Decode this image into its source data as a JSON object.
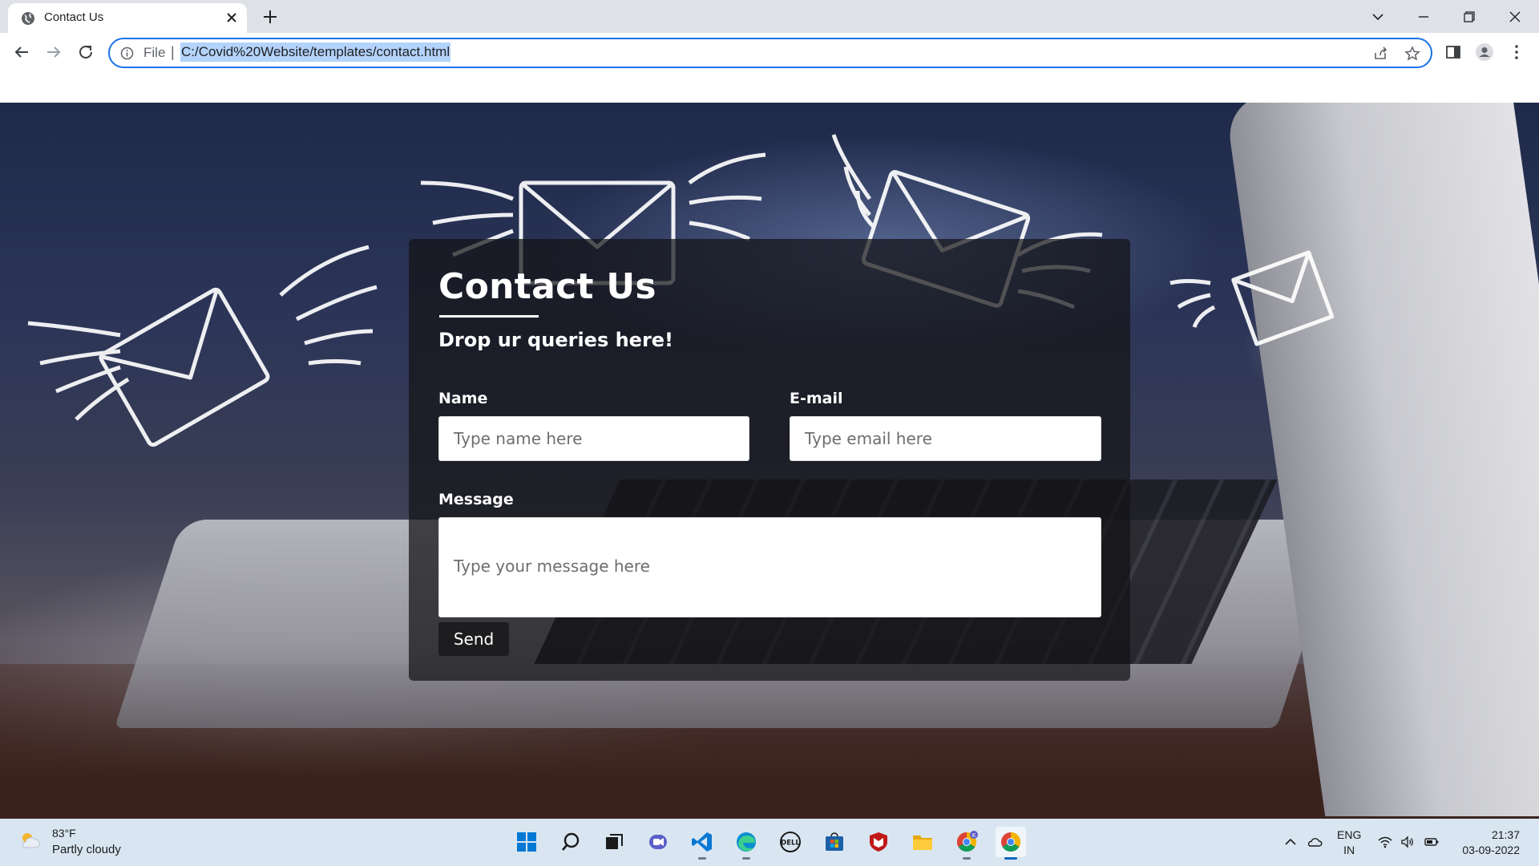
{
  "browser": {
    "tab_title": "Contact Us",
    "omnibox_scheme": "File",
    "omnibox_separator": "|",
    "url": "C:/Covid%20Website/templates/contact.html"
  },
  "contact": {
    "title": "Contact Us",
    "subtitle": "Drop ur queries here!",
    "name_label": "Name",
    "name_placeholder": "Type name here",
    "email_label": "E-mail",
    "email_placeholder": "Type email here",
    "message_label": "Message",
    "message_placeholder": "Type your message here",
    "send_label": "Send"
  },
  "taskbar": {
    "weather_temp": "83°F",
    "weather_desc": "Partly cloudy",
    "lang_line1": "ENG",
    "lang_line2": "IN",
    "time": "21:37",
    "date": "03-09-2022",
    "chrome_profile_badge": "K"
  },
  "colors": {
    "omnibox_border": "#1a73e8",
    "url_selection": "#b3d3fb",
    "taskbar_bg": "#d9e6f2",
    "card_bg": "rgba(20,20,22,0.72)"
  }
}
